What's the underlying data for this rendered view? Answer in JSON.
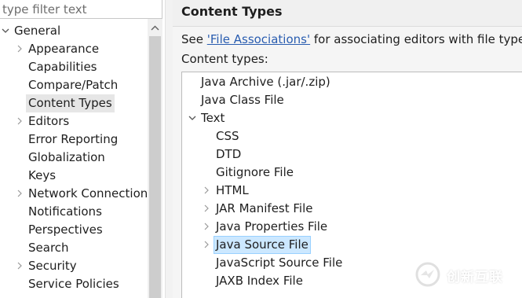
{
  "filter": {
    "placeholder": "type filter text"
  },
  "left_tree": {
    "root": {
      "label": "General",
      "expanded": true
    },
    "items": [
      {
        "label": "Appearance",
        "expandable": true
      },
      {
        "label": "Capabilities",
        "expandable": false
      },
      {
        "label": "Compare/Patch",
        "expandable": false
      },
      {
        "label": "Content Types",
        "expandable": false,
        "selected": true
      },
      {
        "label": "Editors",
        "expandable": true
      },
      {
        "label": "Error Reporting",
        "expandable": false
      },
      {
        "label": "Globalization",
        "expandable": false
      },
      {
        "label": "Keys",
        "expandable": false
      },
      {
        "label": "Network Connections",
        "expandable": true
      },
      {
        "label": "Notifications",
        "expandable": false
      },
      {
        "label": "Perspectives",
        "expandable": false
      },
      {
        "label": "Search",
        "expandable": false
      },
      {
        "label": "Security",
        "expandable": true
      },
      {
        "label": "Service Policies",
        "expandable": false
      }
    ]
  },
  "page": {
    "title": "Content Types",
    "description_prefix": "See ",
    "description_link": "'File Associations'",
    "description_suffix": " for associating editors with file types.",
    "content_types_label": "Content types:"
  },
  "content_tree": {
    "top_items": [
      {
        "label": "Java Archive (.jar/.zip)"
      },
      {
        "label": "Java Class File"
      }
    ],
    "text_node": {
      "label": "Text",
      "expanded": true
    },
    "text_children": [
      {
        "label": "CSS",
        "expandable": false
      },
      {
        "label": "DTD",
        "expandable": false
      },
      {
        "label": "Gitignore File",
        "expandable": false
      },
      {
        "label": "HTML",
        "expandable": true
      },
      {
        "label": "JAR Manifest File",
        "expandable": true
      },
      {
        "label": "Java Properties File",
        "expandable": true
      },
      {
        "label": "Java Source File",
        "expandable": true,
        "selected": true
      },
      {
        "label": "JavaScript Source File",
        "expandable": false
      },
      {
        "label": "JAXB Index File",
        "expandable": false
      }
    ]
  },
  "watermark": {
    "text": "创新互联"
  },
  "colors": {
    "selection": "#cce8ff",
    "selection_border": "#99d1ff",
    "link": "#2a5db0",
    "left_selection": "#e6e6e6"
  }
}
